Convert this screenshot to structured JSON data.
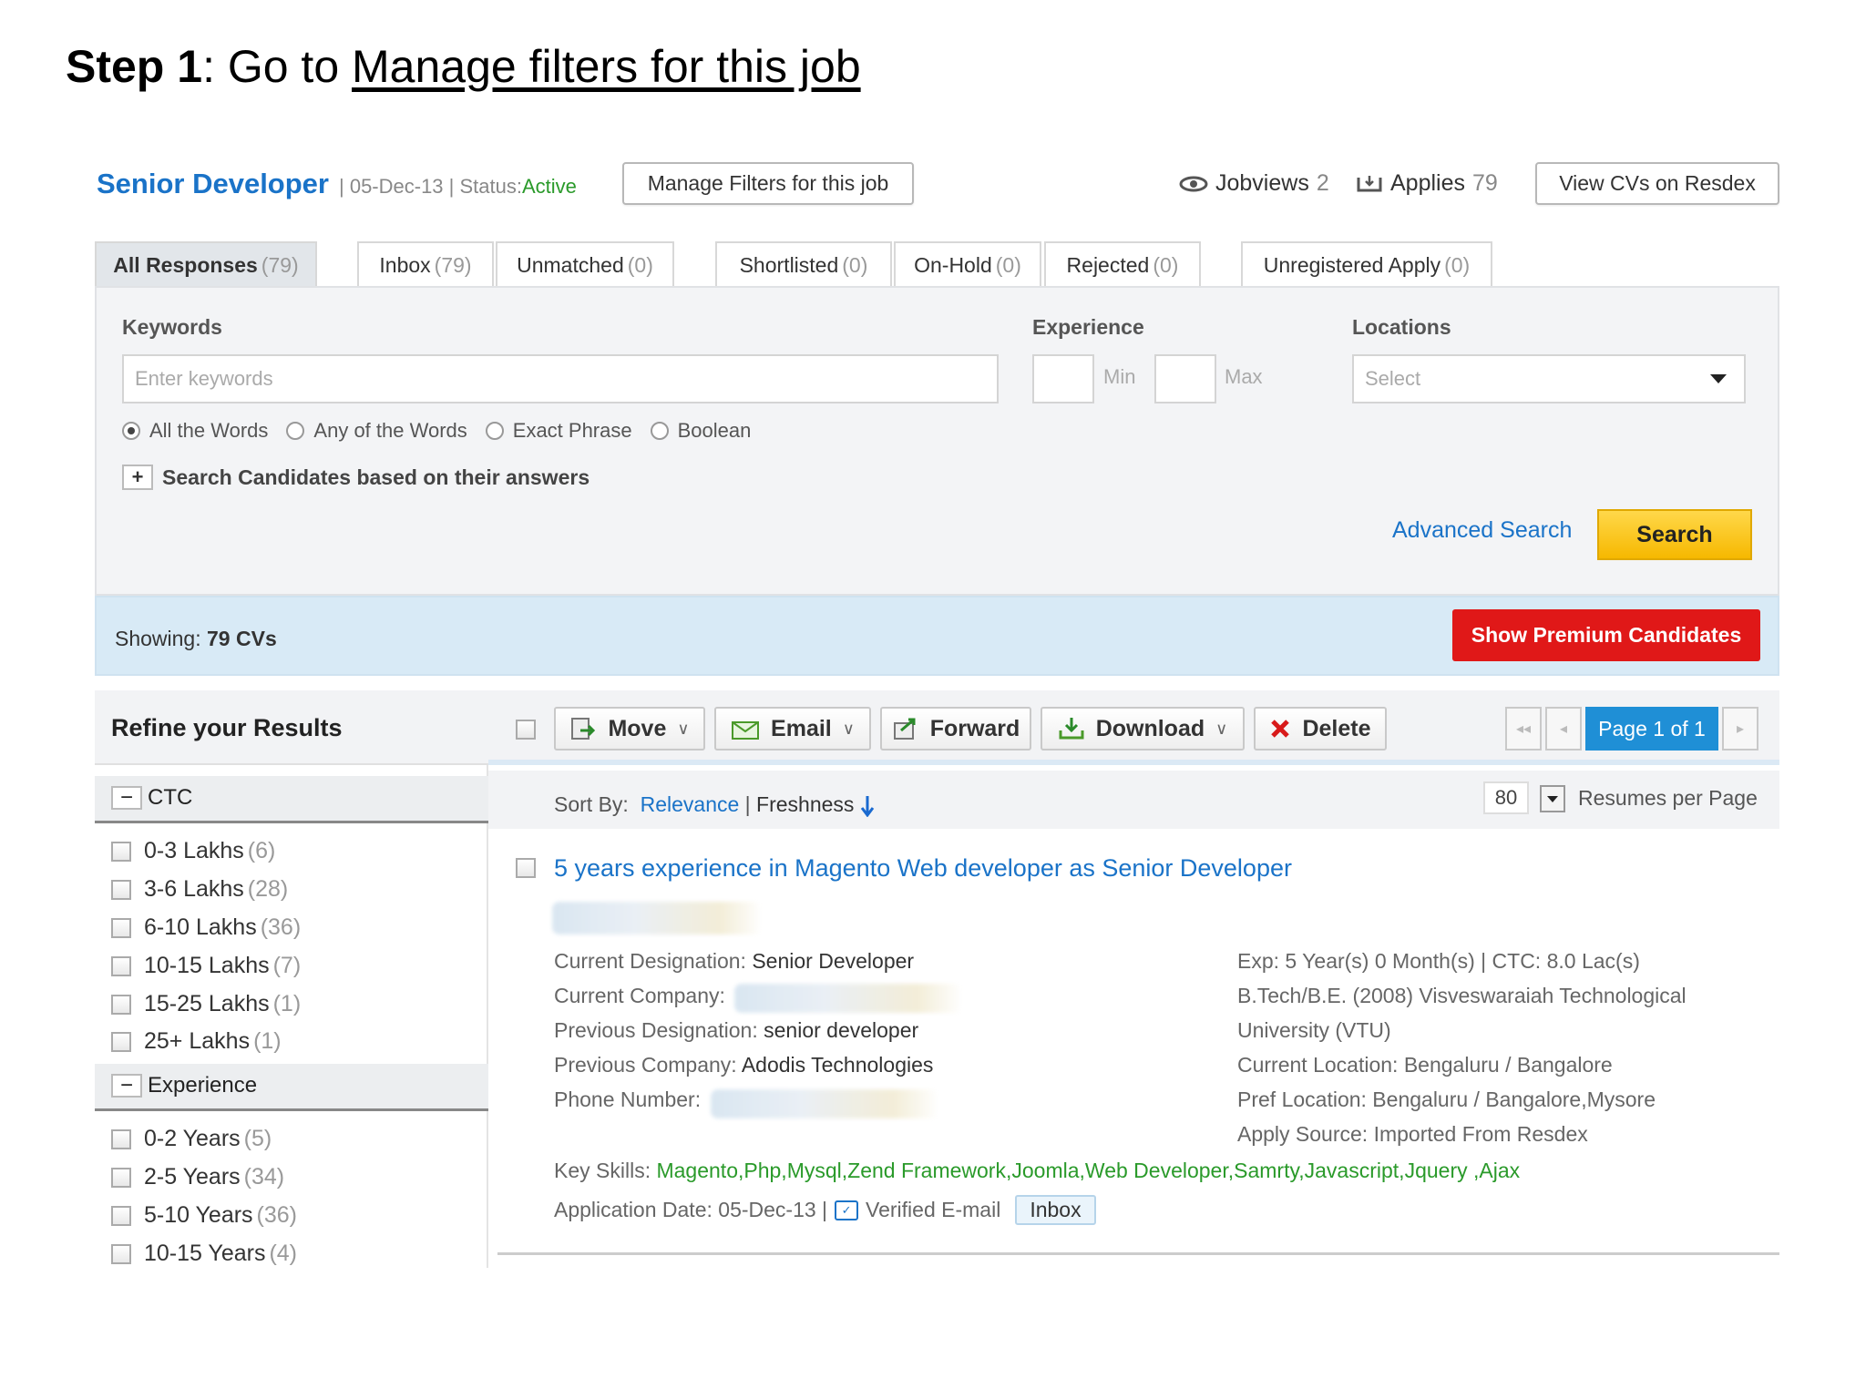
{
  "slide": {
    "step_label": "Step 1",
    "separator": ": Go to ",
    "link_text": "Manage filters for this job"
  },
  "job": {
    "title": "Senior Developer",
    "meta_prefix": "| 05-Dec-13 | Status:",
    "status": "Active",
    "manage_filters_label": "Manage Filters for this job",
    "jobviews_label": "Jobviews",
    "jobviews_count": "2",
    "applies_label": "Applies",
    "applies_count": "79",
    "view_cvs_label": "View CVs on Resdex"
  },
  "tabs": [
    {
      "label": "All Responses",
      "count": "(79)"
    },
    {
      "label": "Inbox",
      "count": "(79)"
    },
    {
      "label": "Unmatched",
      "count": "(0)"
    },
    {
      "label": "Shortlisted",
      "count": "(0)"
    },
    {
      "label": "On-Hold",
      "count": "(0)"
    },
    {
      "label": "Rejected",
      "count": "(0)"
    },
    {
      "label": "Unregistered Apply",
      "count": "(0)"
    }
  ],
  "search": {
    "keywords_label": "Keywords",
    "keywords_placeholder": "Enter keywords",
    "experience_label": "Experience",
    "min_label": "Min",
    "max_label": "Max",
    "locations_label": "Locations",
    "locations_value": "Select",
    "match_options": [
      "All the Words",
      "Any of the Words",
      "Exact Phrase",
      "Boolean"
    ],
    "answers_label": "Search Candidates based on their answers",
    "advanced_label": "Advanced Search",
    "search_button": "Search"
  },
  "showing": {
    "prefix": "Showing:",
    "value": "79 CVs",
    "premium_button": "Show Premium Candidates"
  },
  "sidebar": {
    "title": "Refine your Results",
    "ctc": {
      "title": "CTC",
      "items": [
        {
          "label": "0-3 Lakhs",
          "count": "(6)"
        },
        {
          "label": "3-6 Lakhs",
          "count": "(28)"
        },
        {
          "label": "6-10 Lakhs",
          "count": "(36)"
        },
        {
          "label": "10-15 Lakhs",
          "count": "(7)"
        },
        {
          "label": "15-25 Lakhs",
          "count": "(1)"
        },
        {
          "label": "25+ Lakhs",
          "count": "(1)"
        }
      ]
    },
    "experience": {
      "title": "Experience",
      "items": [
        {
          "label": "0-2 Years",
          "count": "(5)"
        },
        {
          "label": "2-5 Years",
          "count": "(34)"
        },
        {
          "label": "5-10 Years",
          "count": "(36)"
        },
        {
          "label": "10-15 Years",
          "count": "(4)"
        }
      ]
    }
  },
  "toolbar": {
    "move": "Move",
    "email": "Email",
    "forward": "Forward",
    "download": "Download",
    "delete": "Delete",
    "page_indicator": "Page 1 of 1"
  },
  "sort": {
    "label": "Sort By:",
    "relevance": "Relevance",
    "separator": "|",
    "freshness": "Freshness",
    "per_page_value": "80",
    "per_page_label": "Resumes per Page"
  },
  "result": {
    "title": "5 years experience in Magento Web developer as Senior Developer",
    "current_designation_label": "Current Designation:",
    "current_designation": "Senior Developer",
    "current_company_label": "Current Company:",
    "previous_designation_label": "Previous Designation:",
    "previous_designation": "senior developer",
    "previous_company_label": "Previous Company:",
    "previous_company": "Adodis Technologies",
    "phone_label": "Phone Number:",
    "exp_ctc": "Exp: 5 Year(s) 0 Month(s) | CTC: 8.0 Lac(s)",
    "education_line1": "B.Tech/B.E. (2008)  Visveswaraiah Technological",
    "education_line2": "University (VTU)",
    "current_location": "Current Location: Bengaluru / Bangalore",
    "pref_location": "Pref Location: Bengaluru / Bangalore,Mysore",
    "apply_source": "Apply Source: Imported From Resdex",
    "key_skills_label": "Key Skills:",
    "key_skills": "Magento,Php,Mysql,Zend Framework,Joomla,Web Developer,Samrty,Javascript,Jquery ,Ajax",
    "application_date": "Application Date: 05-Dec-13 |",
    "verified_label": "Verified E-mail",
    "folder_badge": "Inbox"
  }
}
